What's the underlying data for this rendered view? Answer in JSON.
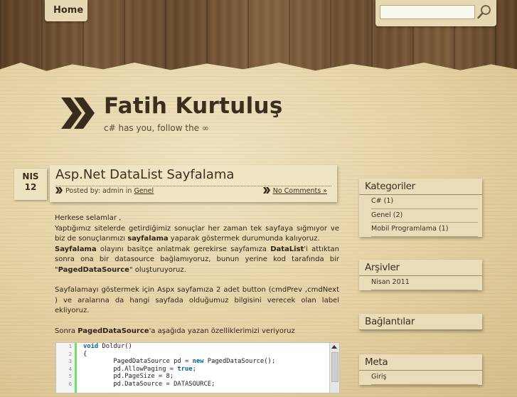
{
  "nav": {
    "home_label": "Home"
  },
  "search": {
    "value": "",
    "placeholder": ""
  },
  "site": {
    "title": "Fatih Kurtuluş",
    "tagline": "c# has you, follow the ∞"
  },
  "post": {
    "date_month": "NIS",
    "date_day": "12",
    "title": "Asp.Net DataList Sayfalama",
    "meta_prefix": "Posted by: admin in",
    "category": "Genel",
    "comments": "No Comments »",
    "body": {
      "p1": "Herkese selamlar ,",
      "p2_a": "Yaptığımız sitelerde getirdiğimiz sonuçlar her zaman tek sayfaya sığmıyor ve biz de sonuçlarımızı ",
      "p2_b": "sayfalama",
      "p2_c": " yaparak göstermek durumunda kalıyoruz.",
      "p3_a": "Sayfalama",
      "p3_b": " olayını basitçe anlatmak gerekirse sayfamıza ",
      "p3_c": "DataList",
      "p3_d": "'i attıktan sonra ona bir datasource bağlamıyoruz, bunun yerine kod tarafında bir \"",
      "p3_e": "PagedDataSource",
      "p3_f": "\" oluşturuyoruz.",
      "p4": "Sayfalamayı göstermek için Aspx sayfamıza 2 adet button (cmdPrev ,cmdNext ) ve aralarına da hangi sayfada olduğumuz bilgisini verecek olan label ekliyoruz.",
      "p5_a": "Sonra ",
      "p5_b": "PagedDataSource",
      "p5_c": "'a aşağıda yazan özelliklerimizi veriyoruz"
    },
    "code": {
      "line_numbers": [
        "1",
        "2",
        "3",
        "4",
        "5",
        "6"
      ],
      "l1_kw": "void",
      "l1_rest": " Doldur()",
      "l2": "{",
      "l3_a": "        PagedDataSource pd = ",
      "l3_kw": "new",
      "l3_b": " PagedDataSource();",
      "l4_a": "        pd.AllowPaging = ",
      "l4_kw": "true",
      "l4_b": ";",
      "l5": "        pd.PageSize = 8;",
      "l6": "        pd.DataSource = DATASOURCE;"
    }
  },
  "sidebar": {
    "categories": {
      "title": "Kategoriler",
      "items": [
        "C# (1)",
        "Genel (2)",
        "Mobil Programlama (1)"
      ]
    },
    "archives": {
      "title": "Arşivler",
      "items": [
        "Nisan 2011"
      ]
    },
    "links": {
      "title": "Bağlantılar"
    },
    "meta": {
      "title": "Meta",
      "items": [
        "Giriş"
      ]
    }
  },
  "colors": {
    "text": "#3c2e1e",
    "paper": "#e4d1a4",
    "wood": "#6a4b2c",
    "code_gutter_bar": "#6ce26c"
  },
  "icons": {
    "search": "magnifier-icon",
    "logo": "double-chevron-icon",
    "meta": "small-double-arrow-icon"
  }
}
